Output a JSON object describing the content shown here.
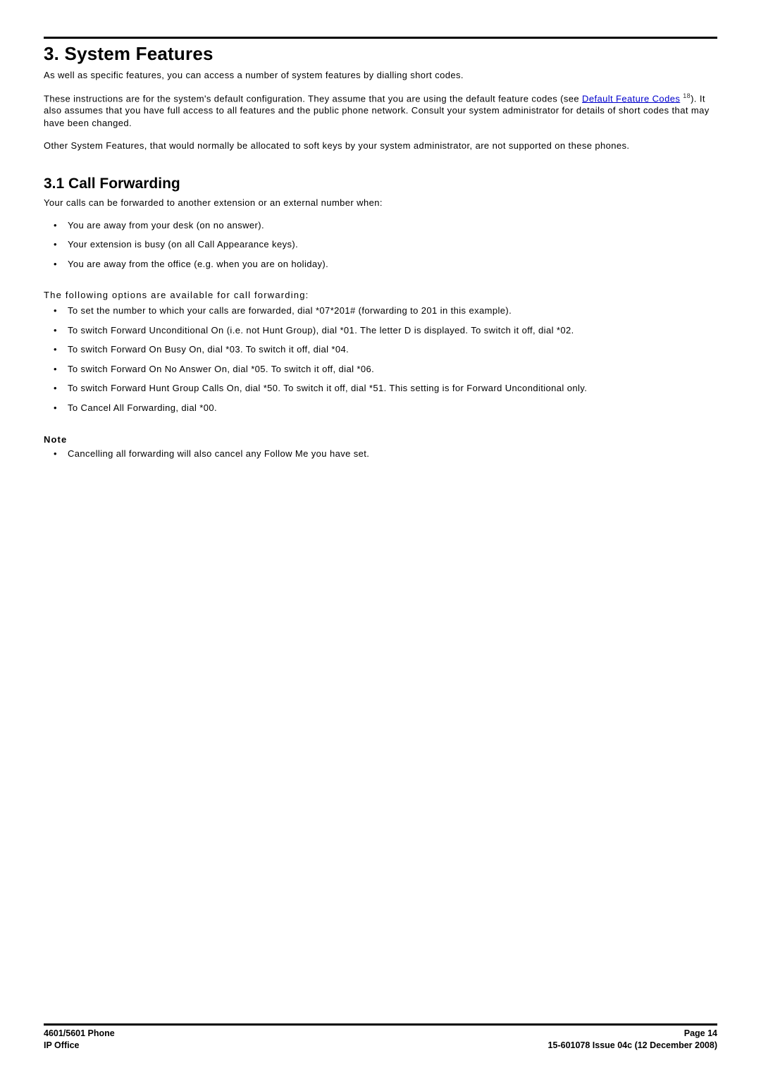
{
  "chapter": {
    "number": "3.",
    "title": "System Features",
    "intro": "As well as specific features, you can access a number of system features by dialling short codes.",
    "para2_pre": "These instructions are for the system's default configuration. They assume that you are using the default feature codes (see ",
    "link_text": "Default Feature Codes",
    "pageref": "18",
    "para2_post": "). It also assumes that you have full access to all features and the public phone network. Consult your system administrator for details of short codes that may have been changed.",
    "para3": "Other System Features, that would normally be allocated to soft keys by your system administrator, are not supported on these phones."
  },
  "section": {
    "number": "3.1",
    "title": "Call Forwarding",
    "lead": "Your calls can be forwarded to another extension or an external number when:",
    "when_bullets": [
      "You are away from your desk (on no answer).",
      "Your extension is busy (on all Call Appearance keys).",
      "You are away from the office (e.g. when you are on holiday)."
    ],
    "options_heading": "The following options are available for call forwarding:",
    "option_bullets": [
      "To set the number to which your calls are forwarded, dial *07*201# (forwarding to 201 in this example).",
      "To switch Forward Unconditional On (i.e. not Hunt Group), dial *01. The letter D is displayed. To switch it off, dial *02.",
      "To switch Forward On Busy On, dial *03. To switch it off, dial *04.",
      "To switch Forward On No Answer On, dial *05. To switch it off, dial *06.",
      "To switch Forward Hunt Group Calls On, dial *50. To switch it off, dial *51. This setting is for Forward Unconditional only.",
      "To Cancel All Forwarding, dial *00."
    ],
    "note_heading": "Note",
    "note_bullets": [
      "Cancelling all forwarding will also cancel any Follow Me you have set."
    ]
  },
  "footer": {
    "left1": "4601/5601 Phone",
    "left2": "IP Office",
    "right1": "Page 14",
    "right2": "15-601078 Issue 04c (12 December 2008)"
  }
}
